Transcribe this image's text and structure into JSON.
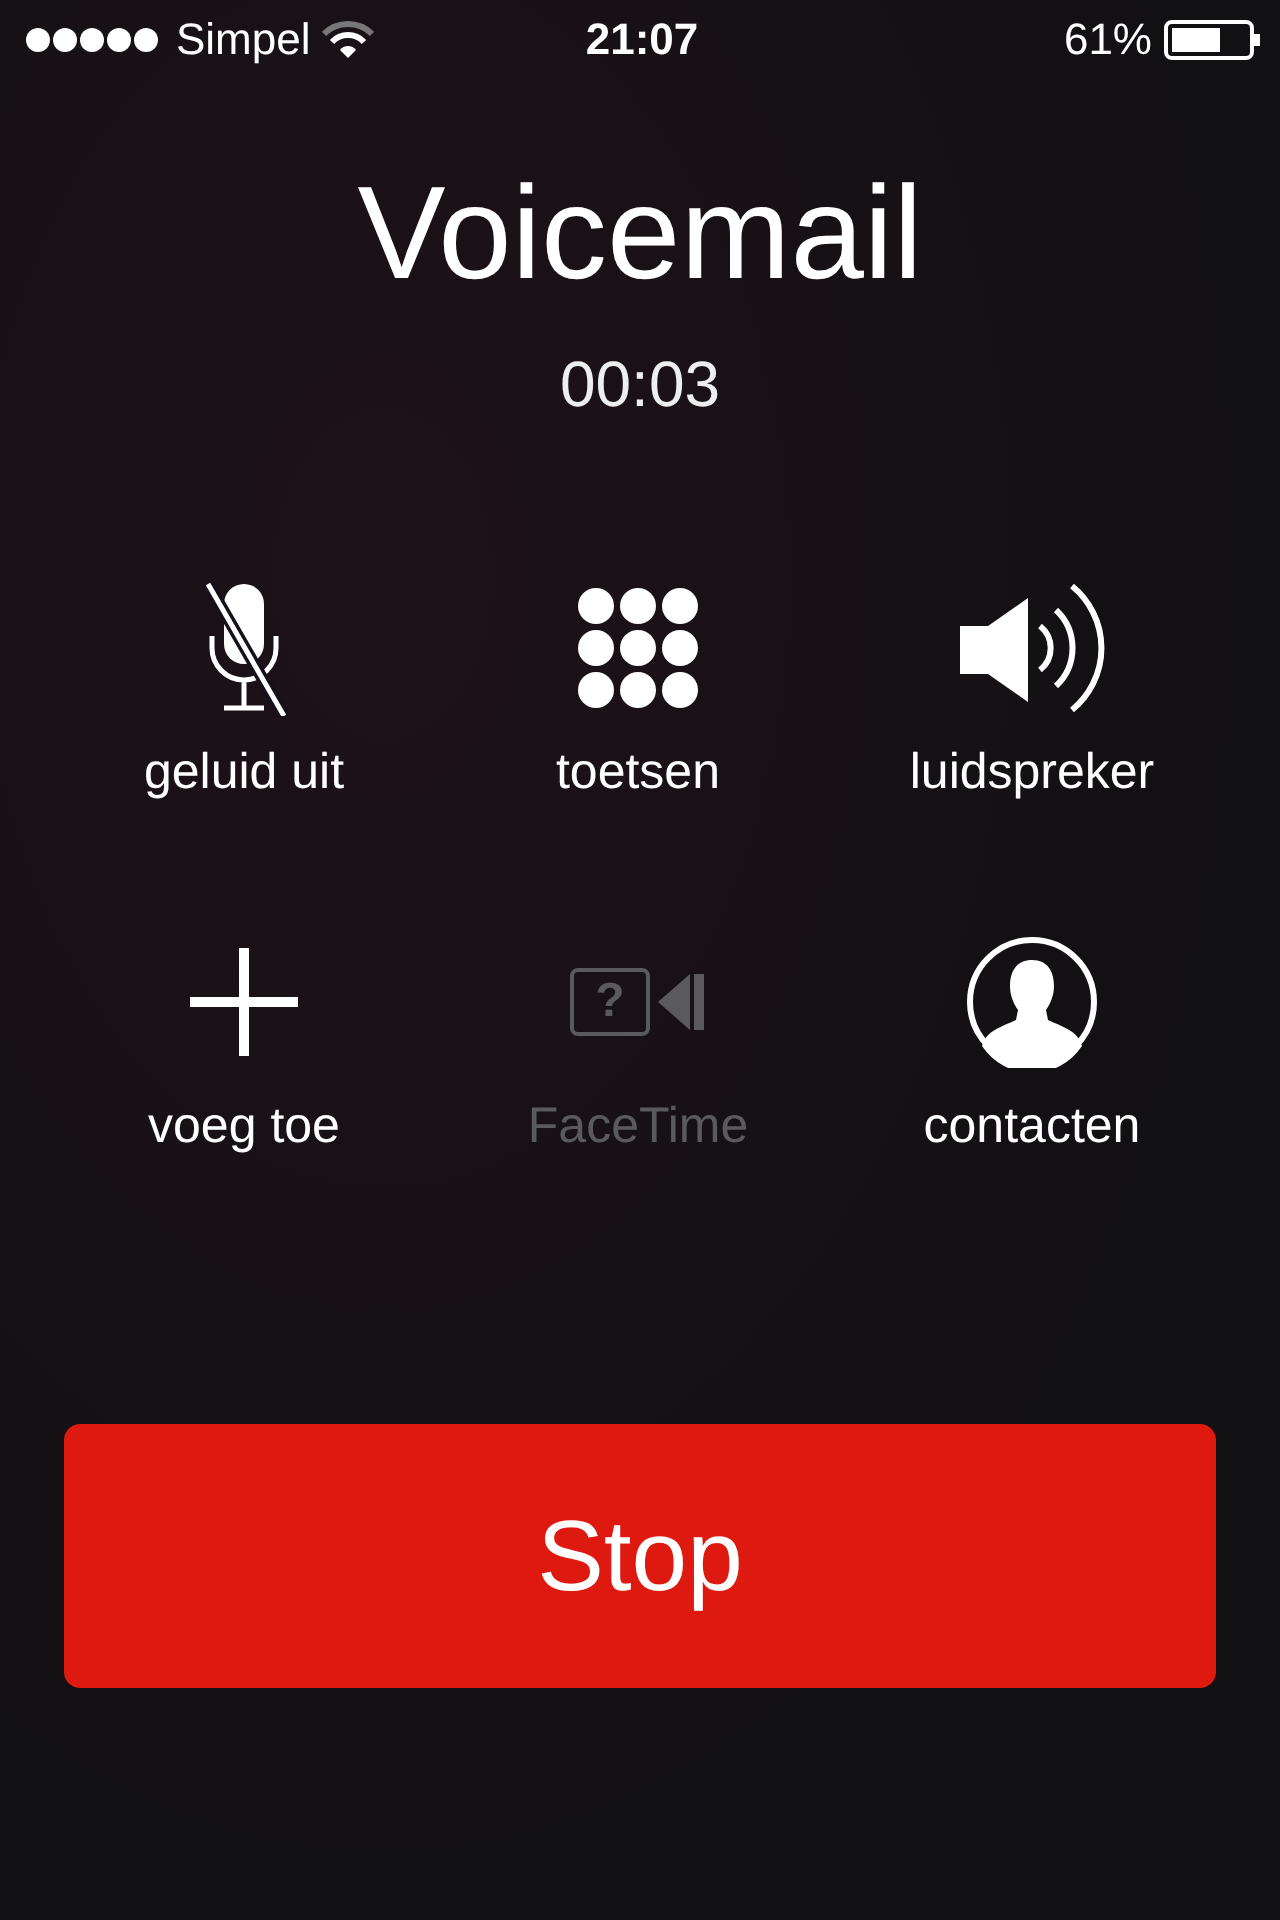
{
  "status_bar": {
    "carrier": "Simpel",
    "time": "21:07",
    "battery": "61%"
  },
  "call": {
    "name": "Voicemail",
    "duration": "00:03"
  },
  "controls": [
    {
      "kind": "mute",
      "label": "geluid uit",
      "disabled": false
    },
    {
      "kind": "keypad",
      "label": "toetsen",
      "disabled": false
    },
    {
      "kind": "speaker",
      "label": "luidspreker",
      "disabled": false
    },
    {
      "kind": "add",
      "label": "voeg toe",
      "disabled": false
    },
    {
      "kind": "facetime",
      "label": "FaceTime",
      "disabled": true,
      "glyph": "?"
    },
    {
      "kind": "contacts",
      "label": "contacten",
      "disabled": false
    }
  ],
  "end_button": {
    "label": "Stop"
  }
}
